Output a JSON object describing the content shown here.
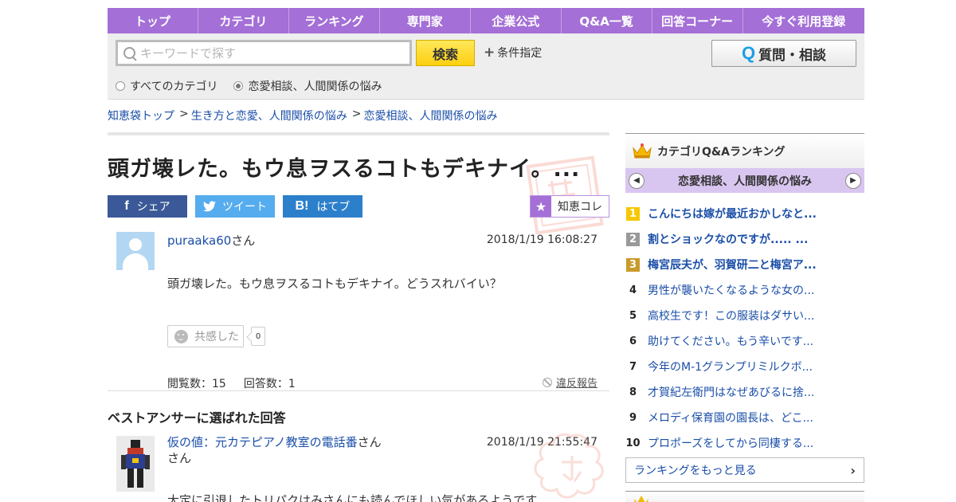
{
  "nav": {
    "items": [
      "トップ",
      "カテゴリ",
      "ランキング",
      "専門家",
      "企業公式",
      "Q&A一覧",
      "回答コーナー",
      "今すぐ利用登録"
    ]
  },
  "search": {
    "placeholder": "キーワードで探す",
    "value": "",
    "button_label": "検索",
    "conditions_label": "条件指定",
    "ask_button_label": "質問・相談",
    "ask_icon": "Q",
    "scope_all": "すべてのカテゴリ",
    "scope_current": "恋愛相談、人間関係の悩み",
    "scope_selected": "current"
  },
  "breadcrumb": {
    "items": [
      "知恵袋トップ",
      "生き方と恋愛、人間関係の悩み",
      "恋愛相談、人間関係の悩み"
    ],
    "separator": ">"
  },
  "question": {
    "title": "頭ガ壊レた。もウ息ヲスるコトもデキナイ。...",
    "share": {
      "facebook_icon": "f",
      "facebook_label": "シェア",
      "twitter_label": "ツイート",
      "hatena_icon": "B!",
      "hatena_label": "はてブ",
      "chiecolle_label": "知恵コレ"
    },
    "user": "puraaka60",
    "user_suffix": "さん",
    "date": "2018/1/19  16:08:27",
    "body": "頭ガ壊レた。もウ息ヲスるコトもデキナイ。どうスれバイい？",
    "empathy_label": "共感した",
    "empathy_count": "0",
    "views_label": "閲覧数：15",
    "answers_label": "回答数：1",
    "report_label": "違反報告"
  },
  "best_answer": {
    "heading": "ベストアンサーに選ばれた回答",
    "user": "仮の値：元カテピアノ教室の電話番",
    "user_suffix": "さん",
    "date": "2018/1/19  21:55:47",
    "body_partial": "大定に引退したトリパクはみさんにも読んでほしい気があるようです..."
  },
  "ranking": {
    "title": "カテゴリQ&Aランキング",
    "category": "恋愛相談、人間関係の悩み",
    "items": [
      {
        "rank": "1",
        "text": "こんにちは嫁が最近おかしなと..."
      },
      {
        "rank": "2",
        "text": "割とショックなのですが..... ..."
      },
      {
        "rank": "3",
        "text": "梅宮辰夫が、羽賀研二と梅宮ア..."
      },
      {
        "rank": "4",
        "text": "男性が襲いたくなるような女の..."
      },
      {
        "rank": "5",
        "text": "高校生です！この服装はダサい..."
      },
      {
        "rank": "6",
        "text": "助けてください。もう辛いです..."
      },
      {
        "rank": "7",
        "text": "今年のM-1グランプリミルクボ..."
      },
      {
        "rank": "8",
        "text": "才賀紀左衛門はなぜあびるに捨..."
      },
      {
        "rank": "9",
        "text": "メロディ保育園の園長は、どこ..."
      },
      {
        "rank": "10",
        "text": "プロポーズをしてから同棲する..."
      }
    ],
    "more_label": "ランキングをもっと見る"
  },
  "colors": {
    "nav_purple": "#a46fd6",
    "link_blue": "#1a4ea8",
    "search_yellow": "#fccf10",
    "facebook": "#3b5998",
    "twitter": "#55acee",
    "hatena": "#2c7fca"
  }
}
